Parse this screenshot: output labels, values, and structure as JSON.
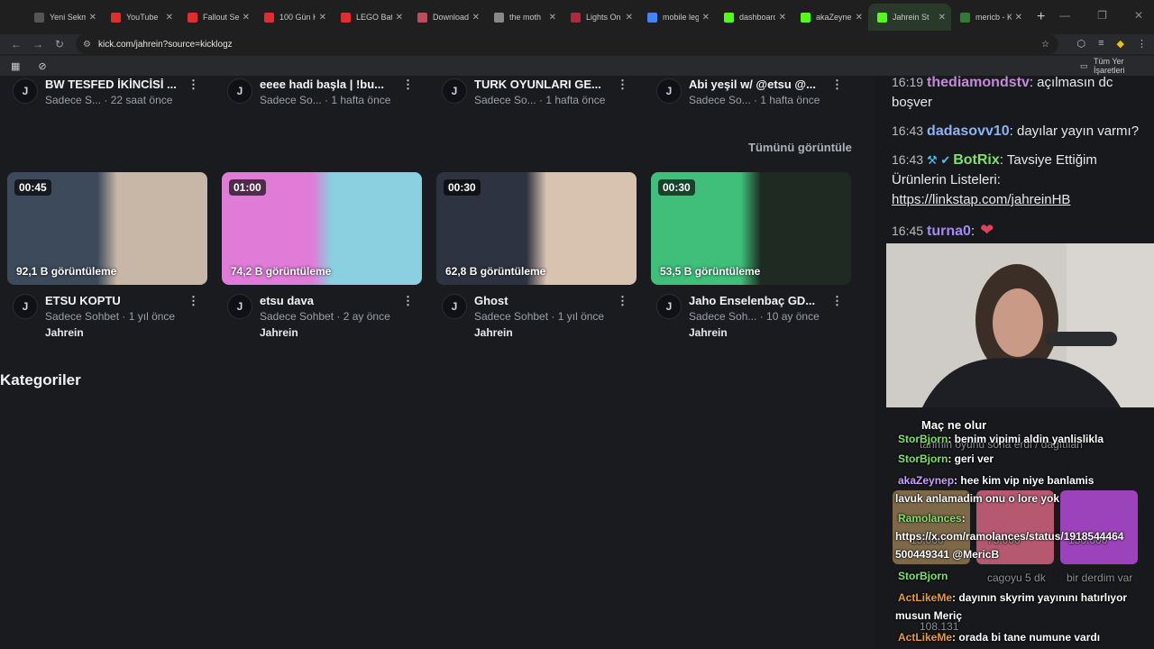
{
  "tabs": [
    {
      "label": "Yeni Sekme",
      "color": "#555"
    },
    {
      "label": "YouTube",
      "color": "#e02d2d"
    },
    {
      "label": "Fallout Se",
      "color": "#e02d2d"
    },
    {
      "label": "100 Gün H",
      "color": "#e02d2d"
    },
    {
      "label": "LEGO Batr",
      "color": "#e02d2d"
    },
    {
      "label": "Download",
      "color": "#c24a5b"
    },
    {
      "label": "the moth",
      "color": "#888"
    },
    {
      "label": "Lights On",
      "color": "#b0283c"
    },
    {
      "label": "mobile leg",
      "color": "#4285f4"
    },
    {
      "label": "dashboard",
      "color": "#53fc18"
    },
    {
      "label": "akaZeyne",
      "color": "#53fc18"
    },
    {
      "label": "Jahrein St",
      "color": "#53fc18",
      "active": true
    },
    {
      "label": "mericb - K",
      "color": "#2e7d32"
    }
  ],
  "address": {
    "url": "kick.com/jahrein?source=kicklogz"
  },
  "bookmarks": {
    "all_label": "Tüm Yer İşaretleri"
  },
  "top_videos": [
    {
      "title": "BW TESFED İKİNCİSİ ...",
      "meta": "Sadece S... · 22 saat önce"
    },
    {
      "title": "eeee hadi başla | !bu...",
      "meta": "Sadece So... · 1 hafta önce"
    },
    {
      "title": "TURK OYUNLARI GE...",
      "meta": "Sadece So... · 1 hafta önce"
    },
    {
      "title": "Abi yeşil w/ @etsu @...",
      "meta": "Sadece So... · 1 hafta önce"
    }
  ],
  "see_all": "Tümünü görüntüle",
  "clips": [
    {
      "duration": "00:45",
      "views": "92,1 B görüntüleme",
      "title": "ETSU KOPTU",
      "meta": "Sadece Sohbet · 1 yıl önce",
      "channel": "Jahrein",
      "c1": "#3d4a5c",
      "c2": "#c8b7a6"
    },
    {
      "duration": "01:00",
      "views": "74,2 B görüntüleme",
      "title": "etsu dava",
      "meta": "Sadece Sohbet · 2 ay önce",
      "channel": "Jahrein",
      "c1": "#e07bd8",
      "c2": "#8ad0e0"
    },
    {
      "duration": "00:30",
      "views": "62,8 B görüntüleme",
      "title": "Ghost",
      "meta": "Sadece Sohbet · 1 yıl önce",
      "channel": "Jahrein",
      "c1": "#2d3340",
      "c2": "#d8c2b0"
    },
    {
      "duration": "00:30",
      "views": "53,5 B görüntüleme",
      "title": "Jaho Enselenbaç GD...",
      "meta": "Sadece Soh... · 10 ay önce",
      "channel": "Jahrein",
      "c1": "#3fbf7a",
      "c2": "#1e2a22"
    }
  ],
  "section_title": "Kategoriler",
  "chat": [
    {
      "time": "16:19",
      "user": "thediamondstv",
      "color": "#c48bd8",
      "text": ": açılmasın dc boşver"
    },
    {
      "time": "16:43",
      "user": "dadasovv10",
      "color": "#8ab4f8",
      "text": ": dayılar yayın varmı?"
    },
    {
      "time": "16:43",
      "user": "BotRix",
      "color": "#7fe36a",
      "text": ": Tavsiye Ettiğim Ürünlerin Listeleri:",
      "link": "https://linkstap.com/jahreinHB"
    },
    {
      "time": "16:45",
      "user": "turna0",
      "color": "#a58af0",
      "text": ":"
    }
  ],
  "overlay": {
    "title": "Maç ne olur",
    "lines": [
      {
        "user": "StorBjorn",
        "color": "#7fe36a",
        "text": ": benim vipimi aldin yanlislikla"
      },
      {
        "user": "StorBjorn",
        "color": "#7fe36a",
        "text": ": geri ver"
      },
      {
        "user": "akaZeynep",
        "color": "#c9a0ff",
        "text": ": hee kim vip niye banlamis"
      },
      {
        "user": "",
        "color": "#fff",
        "text": "lavuk anlamadim onu o lore yok"
      },
      {
        "user": "Ramolances",
        "color": "#7fe36a",
        "text": ":"
      },
      {
        "user": "",
        "color": "#fff",
        "text": "https://x.com/ramolances/status/1918544464"
      },
      {
        "user": "",
        "color": "#fff",
        "text": "500449341 @MericB"
      },
      {
        "user": "StorBjorn",
        "color": "#7fe36a",
        "text": ""
      },
      {
        "user": "ActLikeMe",
        "color": "#e89a3c",
        "text": ": dayının skyrim yayınını hatırlıyor"
      },
      {
        "user": "",
        "color": "#fff",
        "text": "musun Meriç"
      },
      {
        "user": "ActLikeMe",
        "color": "#e89a3c",
        "text": ": orada bi tane numune vardı"
      }
    ],
    "ghost": [
      "tahmin oyunu sona erdi / dağıtılan",
      "15.000",
      "75.000",
      "150.000",
      "cagoyu 5 dk",
      "bir derdim var",
      "108.131"
    ]
  }
}
